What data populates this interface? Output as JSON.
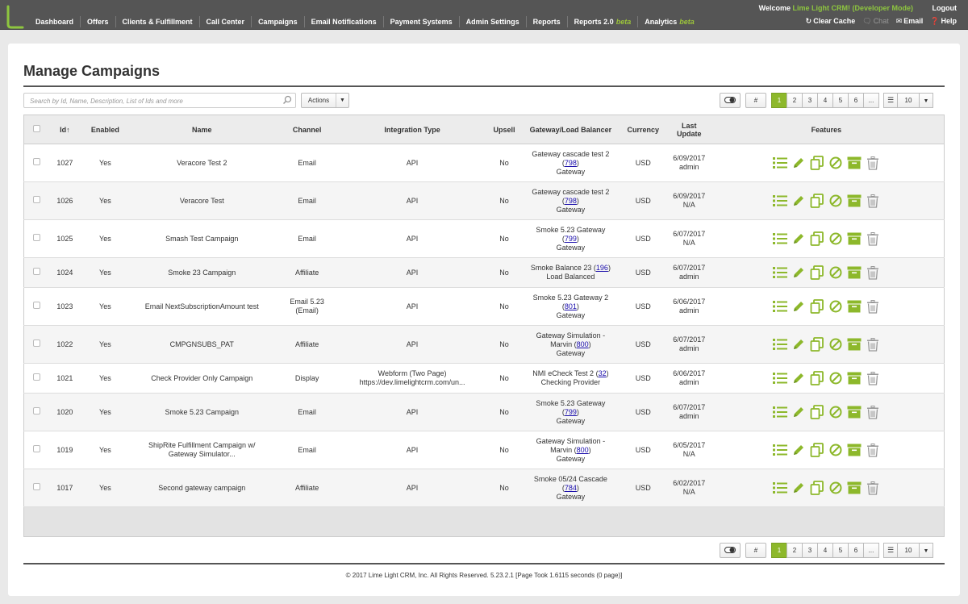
{
  "nav": {
    "items": [
      "Dashboard",
      "Offers",
      "Clients & Fulfillment",
      "Call Center",
      "Campaigns",
      "Email Notifications",
      "Payment Systems",
      "Admin Settings",
      "Reports"
    ],
    "reports2": "Reports 2.0",
    "analytics": "Analytics",
    "beta": "beta"
  },
  "header": {
    "welcome_prefix": "Welcome",
    "welcome_name": "Lime Light CRM! (Developer Mode)",
    "logout": "Logout",
    "clear_cache": "Clear Cache",
    "chat": "Chat",
    "email": "Email",
    "help": "Help"
  },
  "page": {
    "title": "Manage Campaigns",
    "search_placeholder": "Search by Id, Name, Description, List of Ids and more",
    "actions_label": "Actions"
  },
  "pager": {
    "hash": "#",
    "pages": [
      "1",
      "2",
      "3",
      "4",
      "5",
      "6",
      "..."
    ],
    "active_page": "1",
    "page_size": "10"
  },
  "table": {
    "columns": [
      "Id↑",
      "Enabled",
      "Name",
      "Channel",
      "Integration Type",
      "Upsell",
      "Gateway/Load Balancer",
      "Currency",
      "Last Update",
      "Features"
    ],
    "rows": [
      {
        "id": "1027",
        "enabled": "Yes",
        "name": "Veracore Test 2",
        "channel": "Email",
        "integration": "API",
        "upsell": "No",
        "gw_pre": "Gateway cascade test 2",
        "gw_pre_suffix": "",
        "gw_link": "798",
        "gw_paren_line": "new",
        "gw_type": "Gateway",
        "currency": "USD",
        "date": "6/09/2017",
        "user": "admin"
      },
      {
        "id": "1026",
        "enabled": "Yes",
        "name": "Veracore Test",
        "channel": "Email",
        "integration": "API",
        "upsell": "No",
        "gw_pre": "Gateway cascade test 2",
        "gw_link": "798",
        "gw_paren_line": "new",
        "gw_type": "Gateway",
        "currency": "USD",
        "date": "6/09/2017",
        "user": "N/A"
      },
      {
        "id": "1025",
        "enabled": "Yes",
        "name": "Smash Test Campaign",
        "channel": "Email",
        "integration": "API",
        "upsell": "No",
        "gw_pre": "Smoke 5.23 Gateway",
        "gw_link": "799",
        "gw_paren_line": "new",
        "gw_type": "Gateway",
        "currency": "USD",
        "date": "6/07/2017",
        "user": "N/A"
      },
      {
        "id": "1024",
        "enabled": "Yes",
        "name": "Smoke 23 Campaign",
        "channel": "Affiliate",
        "integration": "API",
        "upsell": "No",
        "gw_pre": "Smoke Balance 23",
        "gw_link": "196",
        "gw_paren_line": "same",
        "gw_type": "Load Balanced",
        "currency": "USD",
        "date": "6/07/2017",
        "user": "admin"
      },
      {
        "id": "1023",
        "enabled": "Yes",
        "name": "Email NextSubscriptionAmount test",
        "channel": "Email 5.23",
        "channel2": "(Email)",
        "integration": "API",
        "upsell": "No",
        "gw_pre": "Smoke 5.23 Gateway 2",
        "gw_link": "801",
        "gw_paren_line": "new",
        "gw_type": "Gateway",
        "currency": "USD",
        "date": "6/06/2017",
        "user": "admin"
      },
      {
        "id": "1022",
        "enabled": "Yes",
        "name": "CMPGNSUBS_PAT",
        "channel": "Affiliate",
        "integration": "API",
        "upsell": "No",
        "gw_pre": "Gateway Simulation -",
        "gw_pre2": "Marvin",
        "gw_link": "800",
        "gw_paren_line": "second",
        "gw_type": "Gateway",
        "currency": "USD",
        "date": "6/07/2017",
        "user": "admin"
      },
      {
        "id": "1021",
        "enabled": "Yes",
        "name": "Check Provider Only Campaign",
        "channel": "Display",
        "integration": "Webform (Two Page)",
        "integration2": "https://dev.limelightcrm.com/un...",
        "upsell": "No",
        "gw_pre": "NMI eCheck Test 2",
        "gw_link": "32",
        "gw_paren_line": "same",
        "gw_type": "Checking Provider",
        "currency": "USD",
        "date": "6/06/2017",
        "user": "admin"
      },
      {
        "id": "1020",
        "enabled": "Yes",
        "name": "Smoke 5.23 Campaign",
        "channel": "Email",
        "integration": "API",
        "upsell": "No",
        "gw_pre": "Smoke 5.23 Gateway",
        "gw_link": "799",
        "gw_paren_line": "new",
        "gw_type": "Gateway",
        "currency": "USD",
        "date": "6/07/2017",
        "user": "admin"
      },
      {
        "id": "1019",
        "enabled": "Yes",
        "name": "ShipRite Fulfillment Campaign w/",
        "name2": "Gateway Simulator...",
        "channel": "Email",
        "integration": "API",
        "upsell": "No",
        "gw_pre": "Gateway Simulation -",
        "gw_pre2": "Marvin",
        "gw_link": "800",
        "gw_paren_line": "second",
        "gw_type": "Gateway",
        "currency": "USD",
        "date": "6/05/2017",
        "user": "N/A"
      },
      {
        "id": "1017",
        "enabled": "Yes",
        "name": "Second gateway campaign",
        "channel": "Affiliate",
        "integration": "API",
        "upsell": "No",
        "gw_pre": "Smoke 05/24 Cascade",
        "gw_link": "784",
        "gw_paren_line": "new",
        "gw_type": "Gateway",
        "currency": "USD",
        "date": "6/02/2017",
        "user": "N/A"
      }
    ]
  },
  "feature_icons": [
    "list-icon",
    "edit-icon",
    "copy-icon",
    "disable-icon",
    "archive-icon",
    "trash-icon"
  ],
  "colors": {
    "accent": "#8db82b",
    "topbar": "#555555",
    "yes": "#1a7a1a",
    "no": "#cc0000"
  },
  "footer": {
    "copyright": "© 2017 Lime Light CRM, Inc. All Rights Reserved. 5.23.2.1 [Page Took 1.6115 seconds (0 page)]"
  }
}
